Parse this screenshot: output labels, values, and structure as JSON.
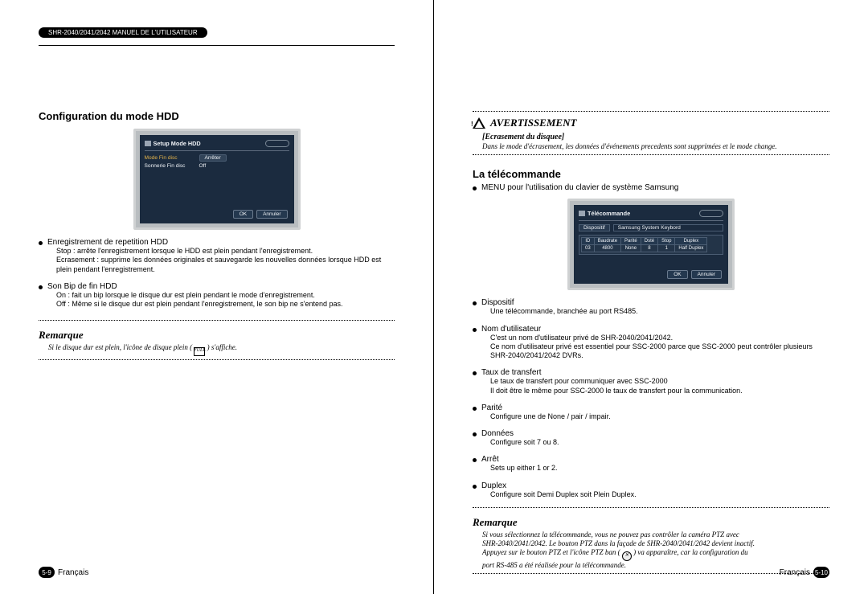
{
  "header": {
    "pill": "SHR-2040/2041/2042 MANUEL DE L'UTILISATEUR"
  },
  "left": {
    "section_title": "Configuration du mode HDD",
    "screen": {
      "title": "Setup Mode HDD",
      "rows": [
        {
          "key": "Mode Fin disc",
          "value": "Arrêter",
          "highlight": true
        },
        {
          "key": "Sonnerie Fin disc",
          "value": "Off",
          "highlight": false
        }
      ],
      "ok": "OK",
      "cancel": "Annuler"
    },
    "bullets": [
      {
        "title": "Enregistrement de repetition HDD",
        "body": "Stop : arrête l'enregistrement lorsque le HDD est plein pendant l'enregistrement.\nEcrasement : supprime les données originales et sauvegarde les nouvelles données lorsque HDD est plein pendant l'enregistrement."
      },
      {
        "title": "Son Bip de fin HDD",
        "body": "On : fait un bip lorsque le disque dur est plein pendant le mode d'enregistrement.\nOff : Même si le disque dur est plein pendant l'enregistrement, le son bip ne s'entend pas."
      }
    ],
    "remarque_label": "Remarque",
    "remarque_prefix": "Si le disque dur est plein, l'icône de disque plein (",
    "remarque_suffix": ") s'affiche.",
    "remarque_icon_text": "FULL",
    "footer_lang": "Français",
    "footer_num": "5-9"
  },
  "right": {
    "warning_label": "AVERTISSEMENT",
    "ecrasement_title": "[Ecrasement du disquee]",
    "ecrasement_body": "Dans le mode d'écrasement, les données d'événements precedents sont supprimées et le mode change.",
    "section_title": "La télécommande",
    "menu_line": "MENU pour l'utilisation du clavier de système Samsung",
    "screen": {
      "title": "Télécommande",
      "device_label": "Dispositif",
      "device_value": "Samsung System Keybord",
      "table": {
        "headers": [
          "ID",
          "Baudrate",
          "Parité",
          "Dsté",
          "Stop",
          "Duplex"
        ],
        "row": [
          "03",
          "4800",
          "None",
          "8",
          "1",
          "Half Duplex"
        ]
      },
      "ok": "OK",
      "cancel": "Annuler"
    },
    "bullets": [
      {
        "title": "Dispositif",
        "body": "Une télécommande, branchée au port RS485."
      },
      {
        "title": "Nom d'utilisateur",
        "body": "C'est un nom d'utilisateur privé de SHR-2040/2041/2042.\nCe nom d'utilisateur privé est essentiel pour SSC-2000 parce que SSC-2000 peut contrôler plusieurs  SHR-2040/2041/2042 DVRs."
      },
      {
        "title": "Taux de transfert",
        "body": "Le taux de transfert pour communiquer avec SSC-2000\nIl doit être le même pour SSC-2000 le taux de transfert pour la communication."
      },
      {
        "title": "Parité",
        "body": "Configure une de None / pair / impair."
      },
      {
        "title": "Données",
        "body": "Configure soit 7 ou 8."
      },
      {
        "title": "Arrêt",
        "body": "Sets up either 1 or 2."
      },
      {
        "title": "Duplex",
        "body": "Configure soit Demi Duplex soit Plein Duplex."
      }
    ],
    "remarque_label": "Remarque",
    "remarque_lines": [
      "Si vous sélectionnez la télécommande, vous ne pouvez pas contrôler la caméra PTZ avec",
      "SHR-2040/2041/2042. Le bouton PTZ dans la façade de SHR-2040/2041/2042 devient inactif.",
      "Appuyez sur le bouton PTZ et l'icône PTZ ban (",
      ") va apparaître, car la configuration du",
      "port RS-485 a été réalisée pour la télécommande."
    ],
    "footer_lang": "Français",
    "footer_num": "5-10"
  }
}
